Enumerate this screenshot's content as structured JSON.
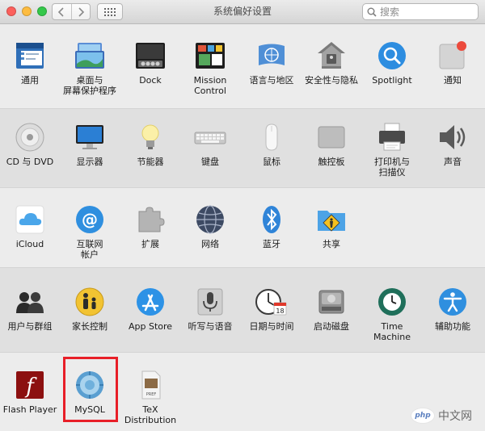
{
  "window": {
    "title": "系统偏好设置",
    "search_placeholder": "搜索"
  },
  "sections": [
    {
      "items": [
        {
          "name": "general",
          "label": "通用"
        },
        {
          "name": "desktop-screensaver",
          "label": "桌面与\n屏幕保护程序"
        },
        {
          "name": "dock",
          "label": "Dock"
        },
        {
          "name": "mission-control",
          "label": "Mission\nControl"
        },
        {
          "name": "language-region",
          "label": "语言与地区"
        },
        {
          "name": "security-privacy",
          "label": "安全性与隐私"
        },
        {
          "name": "spotlight",
          "label": "Spotlight"
        },
        {
          "name": "notifications",
          "label": "通知"
        }
      ]
    },
    {
      "items": [
        {
          "name": "cd-dvd",
          "label": "CD 与 DVD"
        },
        {
          "name": "displays",
          "label": "显示器"
        },
        {
          "name": "energy-saver",
          "label": "节能器"
        },
        {
          "name": "keyboard",
          "label": "键盘"
        },
        {
          "name": "mouse",
          "label": "鼠标"
        },
        {
          "name": "trackpad",
          "label": "触控板"
        },
        {
          "name": "printers-scanners",
          "label": "打印机与\n扫描仪"
        },
        {
          "name": "sound",
          "label": "声音"
        }
      ]
    },
    {
      "items": [
        {
          "name": "icloud",
          "label": "iCloud"
        },
        {
          "name": "internet-accounts",
          "label": "互联网\n帐户"
        },
        {
          "name": "extensions",
          "label": "扩展"
        },
        {
          "name": "network",
          "label": "网络"
        },
        {
          "name": "bluetooth",
          "label": "蓝牙"
        },
        {
          "name": "sharing",
          "label": "共享"
        }
      ]
    },
    {
      "items": [
        {
          "name": "users-groups",
          "label": "用户与群组"
        },
        {
          "name": "parental-controls",
          "label": "家长控制"
        },
        {
          "name": "app-store",
          "label": "App Store"
        },
        {
          "name": "dictation-speech",
          "label": "听写与语音"
        },
        {
          "name": "date-time",
          "label": "日期与时间"
        },
        {
          "name": "startup-disk",
          "label": "启动磁盘"
        },
        {
          "name": "time-machine",
          "label": "Time Machine"
        },
        {
          "name": "accessibility",
          "label": "辅助功能"
        }
      ]
    },
    {
      "items": [
        {
          "name": "flash-player",
          "label": "Flash Player"
        },
        {
          "name": "mysql",
          "label": "MySQL"
        },
        {
          "name": "tex-distribution",
          "label": "TeX\nDistribution"
        }
      ]
    }
  ],
  "icons": {
    "datetime_day": "18",
    "flash_glyph": "f",
    "tex_glyph": "PREF"
  },
  "watermark": {
    "logo": "php",
    "text": "中文网"
  },
  "colors": {
    "highlight": "#e81f28",
    "accent": "#1a8fe3"
  }
}
